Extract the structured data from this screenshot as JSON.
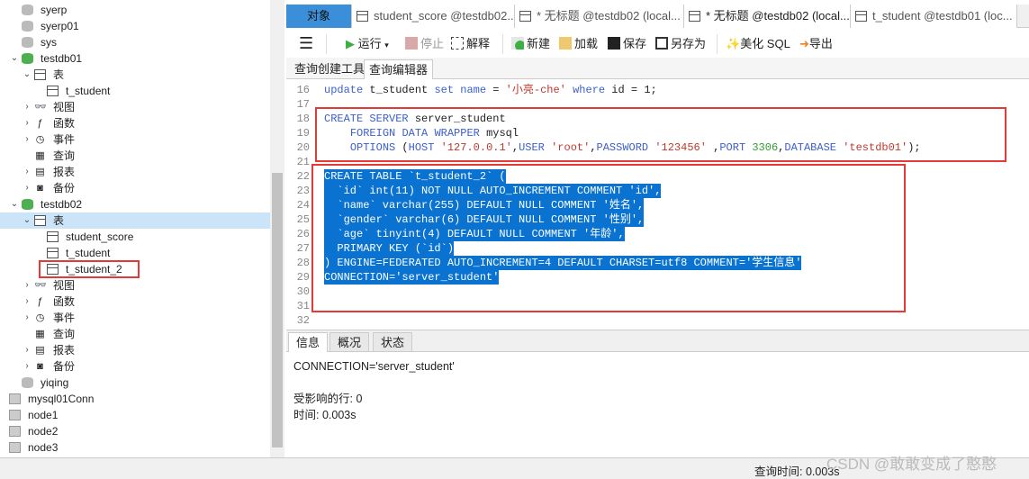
{
  "sidebar": {
    "items": [
      {
        "label": "syerp",
        "level": 1,
        "icon": "db-grey-icon"
      },
      {
        "label": "syerp01",
        "level": 1,
        "icon": "db-grey-icon"
      },
      {
        "label": "sys",
        "level": 1,
        "icon": "db-grey-icon"
      },
      {
        "label": "testdb01",
        "level": 1,
        "icon": "db-icon",
        "expanded": true
      },
      {
        "label": "表",
        "level": 2,
        "icon": "table-icon",
        "expanded": true
      },
      {
        "label": "t_student",
        "level": 3,
        "icon": "table-icon"
      },
      {
        "label": "视图",
        "level": 2,
        "icon": "view-icon",
        "collapsed": true
      },
      {
        "label": "函数",
        "level": 2,
        "icon": "function-icon",
        "collapsed": true
      },
      {
        "label": "事件",
        "level": 2,
        "icon": "event-icon",
        "collapsed": true
      },
      {
        "label": "查询",
        "level": 2,
        "icon": "query-icon"
      },
      {
        "label": "报表",
        "level": 2,
        "icon": "report-icon",
        "collapsed": true
      },
      {
        "label": "备份",
        "level": 2,
        "icon": "backup-icon",
        "collapsed": true
      },
      {
        "label": "testdb02",
        "level": 1,
        "icon": "db-icon",
        "expanded": true
      },
      {
        "label": "表",
        "level": 2,
        "icon": "table-icon",
        "expanded": true,
        "selected": true
      },
      {
        "label": "student_score",
        "level": 3,
        "icon": "table-icon"
      },
      {
        "label": "t_student",
        "level": 3,
        "icon": "table-icon"
      },
      {
        "label": "t_student_2",
        "level": 3,
        "icon": "table-icon",
        "boxed": true
      },
      {
        "label": "视图",
        "level": 2,
        "icon": "view-icon",
        "collapsed": true
      },
      {
        "label": "函数",
        "level": 2,
        "icon": "function-icon",
        "collapsed": true
      },
      {
        "label": "事件",
        "level": 2,
        "icon": "event-icon",
        "collapsed": true
      },
      {
        "label": "查询",
        "level": 2,
        "icon": "query-icon"
      },
      {
        "label": "报表",
        "level": 2,
        "icon": "report-icon",
        "collapsed": true
      },
      {
        "label": "备份",
        "level": 2,
        "icon": "backup-icon",
        "collapsed": true
      },
      {
        "label": "yiqing",
        "level": 1,
        "icon": "db-grey-icon"
      },
      {
        "label": "mysql01Conn",
        "level": 0,
        "icon": "connection-icon"
      },
      {
        "label": "node1",
        "level": 0,
        "icon": "connection-icon"
      },
      {
        "label": "node2",
        "level": 0,
        "icon": "connection-icon"
      },
      {
        "label": "node3",
        "level": 0,
        "icon": "connection-icon"
      }
    ]
  },
  "tabs": [
    "对象",
    "student_score @testdb02...",
    "* 无标题 @testdb02 (local...",
    "* 无标题 @testdb02 (local...",
    "t_student @testdb01 (loc..."
  ],
  "toolbar": {
    "run": "运行",
    "stop": "停止",
    "explain": "解释",
    "new": "新建",
    "load": "加载",
    "save": "保存",
    "save_as": "另存为",
    "beautify": "美化 SQL",
    "export": "导出"
  },
  "subtabs": [
    "查询创建工具",
    "查询编辑器"
  ],
  "editor": {
    "lines": [
      {
        "n": "16",
        "code": "update t_student set name = '小亮-che' where id = 1;"
      },
      {
        "n": "17",
        "code": ""
      },
      {
        "n": "18",
        "code": "CREATE SERVER server_student"
      },
      {
        "n": "19",
        "code": "    FOREIGN DATA WRAPPER mysql"
      },
      {
        "n": "20",
        "code": "    OPTIONS (HOST '127.0.0.1',USER 'root',PASSWORD '123456' ,PORT 3306,DATABASE 'testdb01');"
      },
      {
        "n": "21",
        "code": ""
      },
      {
        "n": "22",
        "code": "CREATE TABLE `t_student_2` (",
        "hl": true
      },
      {
        "n": "23",
        "code": "  `id` int(11) NOT NULL AUTO_INCREMENT COMMENT 'id',",
        "hl": true
      },
      {
        "n": "24",
        "code": "  `name` varchar(255) DEFAULT NULL COMMENT '姓名',",
        "hl": true
      },
      {
        "n": "25",
        "code": "  `gender` varchar(6) DEFAULT NULL COMMENT '性别',",
        "hl": true
      },
      {
        "n": "26",
        "code": "  `age` tinyint(4) DEFAULT NULL COMMENT '年龄',",
        "hl": true
      },
      {
        "n": "27",
        "code": "  PRIMARY KEY (`id`)",
        "hl": true
      },
      {
        "n": "28",
        "code": ") ENGINE=FEDERATED AUTO_INCREMENT=4 DEFAULT CHARSET=utf8 COMMENT='学生信息'",
        "hl": true
      },
      {
        "n": "29",
        "code": "CONNECTION='server_student'",
        "hl": true
      },
      {
        "n": "30",
        "code": ""
      },
      {
        "n": "31",
        "code": ""
      },
      {
        "n": "32",
        "code": ""
      }
    ]
  },
  "bottom_tabs": [
    "信息",
    "概况",
    "状态"
  ],
  "result": {
    "line1": "CONNECTION='server_student'",
    "line2": "受影响的行: 0",
    "line3": "时间: 0.003s"
  },
  "status": {
    "query_time": "查询时间: 0.003s"
  },
  "watermark": "CSDN @敢敢变成了憨憨",
  "colors": {
    "accent": "#3b8fd9",
    "selection": "#0a72d1",
    "highlight_box": "#e53935"
  }
}
